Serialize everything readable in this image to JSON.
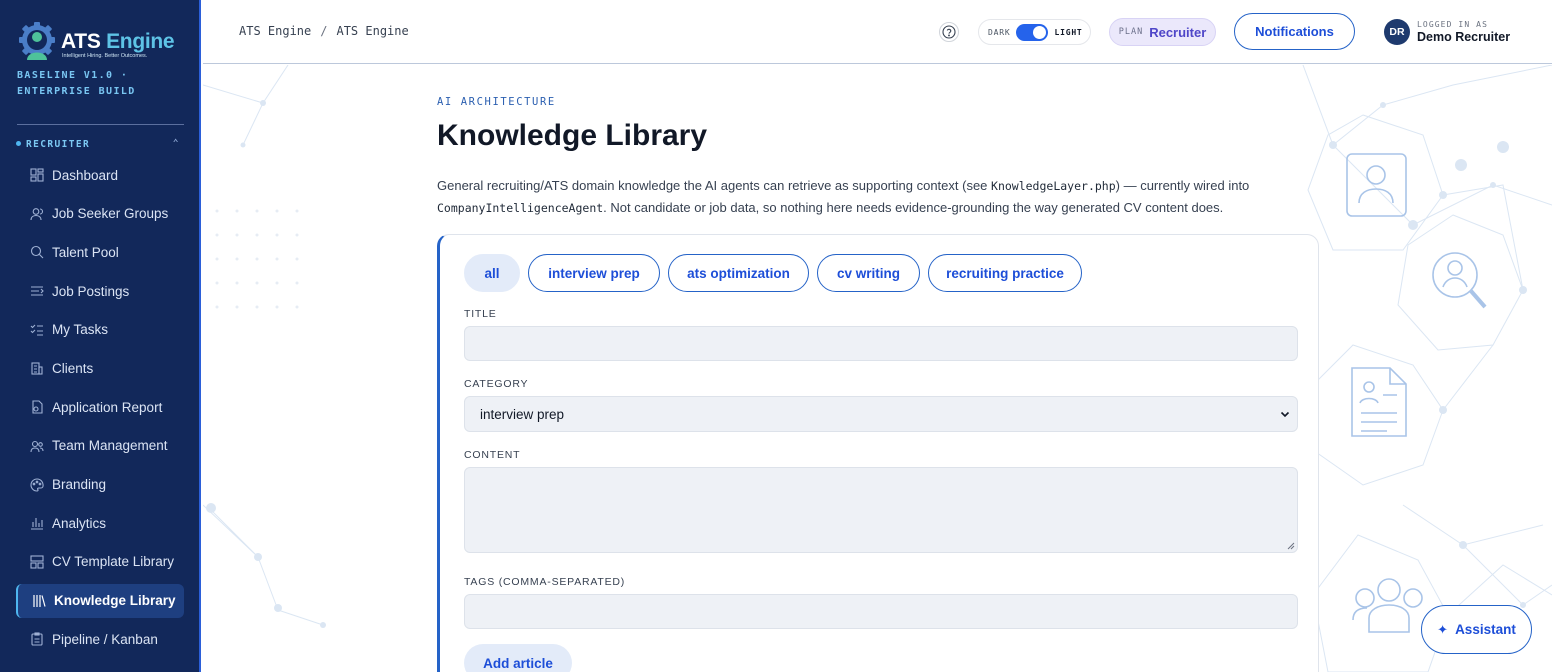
{
  "app": {
    "logo_text_1": "ATS",
    "logo_text_2": "Engine",
    "logo_tagline": "Intelligent Hiring. Better Outcomes.",
    "build_line": "BASELINE V1.0 · ENTERPRISE BUILD"
  },
  "sidebar": {
    "section_label": "RECRUITER",
    "items": [
      {
        "label": "Dashboard",
        "icon": "dashboard-icon"
      },
      {
        "label": "Job Seeker Groups",
        "icon": "users-icon"
      },
      {
        "label": "Talent Pool",
        "icon": "search-icon"
      },
      {
        "label": "Job Postings",
        "icon": "postings-icon"
      },
      {
        "label": "My Tasks",
        "icon": "tasks-icon"
      },
      {
        "label": "Clients",
        "icon": "building-icon"
      },
      {
        "label": "Application Report",
        "icon": "report-icon"
      },
      {
        "label": "Team Management",
        "icon": "team-icon"
      },
      {
        "label": "Branding",
        "icon": "palette-icon"
      },
      {
        "label": "Analytics",
        "icon": "bar-chart-icon"
      },
      {
        "label": "CV Template Library",
        "icon": "template-icon"
      },
      {
        "label": "Knowledge Library",
        "icon": "library-icon",
        "active": true
      },
      {
        "label": "Pipeline / Kanban",
        "icon": "clipboard-icon"
      }
    ]
  },
  "header": {
    "breadcrumb": [
      "ATS Engine",
      "ATS Engine"
    ],
    "breadcrumb_separator": "/",
    "theme_dark": "DARK",
    "theme_light": "LIGHT",
    "plan_label": "PLAN",
    "plan_value": "Recruiter",
    "notifications_label": "Notifications",
    "avatar_initials": "DR",
    "logged_in_label": "LOGGED IN AS",
    "user_name": "Demo Recruiter"
  },
  "main": {
    "eyebrow": "AI ARCHITECTURE",
    "title": "Knowledge Library",
    "desc_1": "General recruiting/ATS domain knowledge the AI agents can retrieve as supporting context (see ",
    "desc_code_1": "KnowledgeLayer.php",
    "desc_2": ") — currently wired into ",
    "desc_code_2": "CompanyIntelligenceAgent",
    "desc_3": ". Not candidate or job data, so nothing here needs evidence-grounding the way generated CV content does.",
    "filters": [
      {
        "label": "all",
        "active": true
      },
      {
        "label": "interview prep"
      },
      {
        "label": "ats optimization"
      },
      {
        "label": "cv writing"
      },
      {
        "label": "recruiting practice"
      }
    ],
    "form": {
      "title_label": "TITLE",
      "title_value": "",
      "category_label": "CATEGORY",
      "category_value": "interview prep",
      "content_label": "CONTENT",
      "content_value": "",
      "tags_label": "TAGS (COMMA-SEPARATED)",
      "tags_value": "",
      "submit_label": "Add article"
    }
  },
  "assistant": {
    "label": "Assistant"
  },
  "colors": {
    "sidebar_bg": "#12285a",
    "accent": "#2563c8",
    "active_pill_bg": "#e3ebf9",
    "plan_bg": "#ebe8fb"
  }
}
